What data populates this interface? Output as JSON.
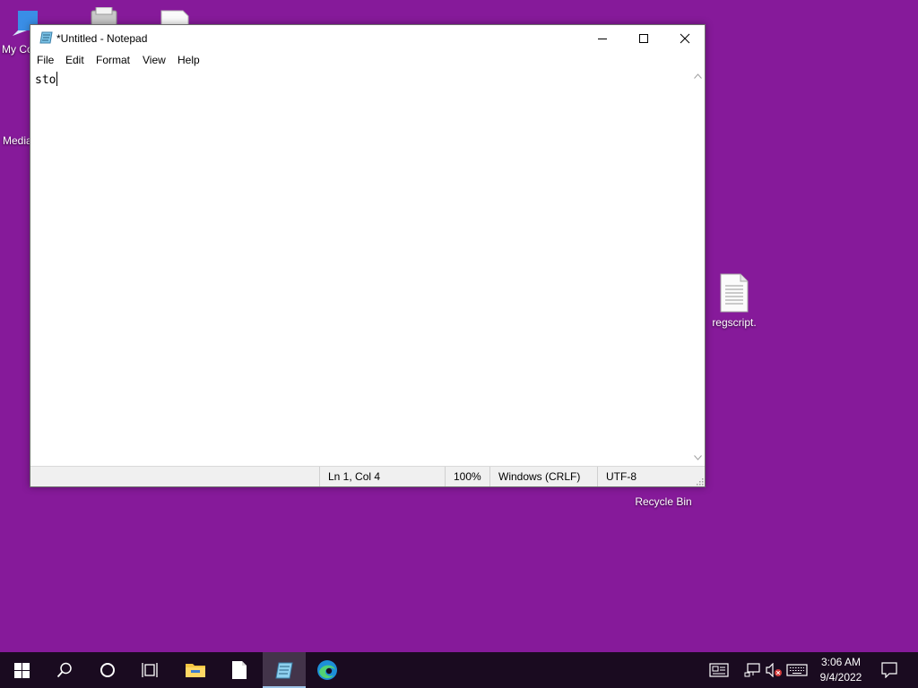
{
  "desktop": {
    "background": "#861a9a",
    "icons": [
      {
        "label": "My Co"
      },
      {
        "label": "Media"
      },
      {
        "label": "regscript."
      },
      {
        "label": "Recycle Bin"
      }
    ]
  },
  "notepad": {
    "title": "*Untitled - Notepad",
    "menu": [
      "File",
      "Edit",
      "Format",
      "View",
      "Help"
    ],
    "content": "sto",
    "status": {
      "position": "Ln 1, Col 4",
      "zoom": "100%",
      "line_ending": "Windows (CRLF)",
      "encoding": "UTF-8"
    }
  },
  "taskbar": {
    "background": "#1a0b20",
    "clock_time": "3:06 AM",
    "clock_date": "9/4/2022"
  }
}
